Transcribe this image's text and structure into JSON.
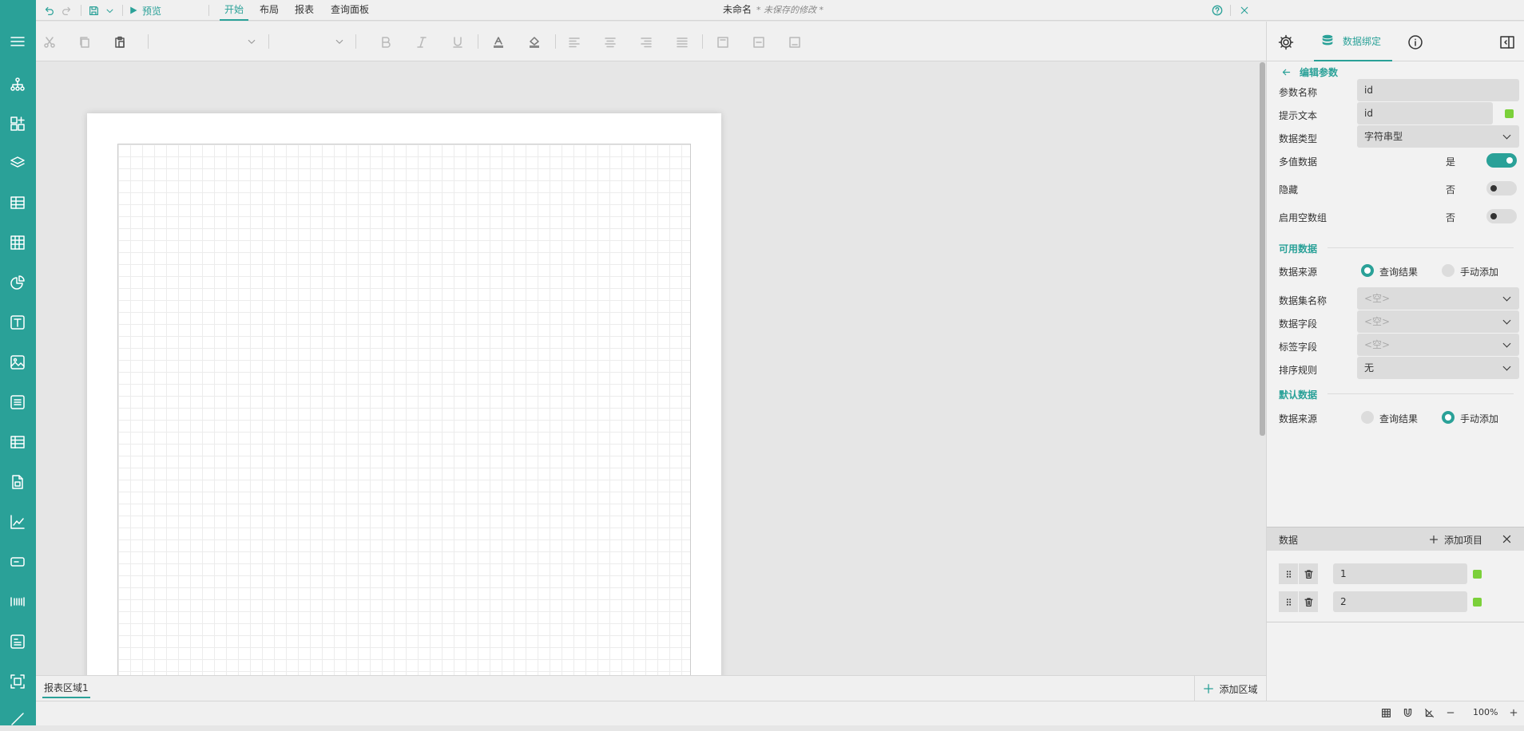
{
  "topbar": {
    "preview_label": "预览",
    "tabs": [
      "开始",
      "布局",
      "报表",
      "查询面板"
    ],
    "doc_title": "未命名",
    "unsaved_note": "* 未保存的修改 *"
  },
  "right_panel": {
    "data_binding_tab": "数据绑定",
    "back_label": "编辑参数",
    "fields": {
      "param_name": {
        "label": "参数名称",
        "value": "id"
      },
      "prompt_text": {
        "label": "提示文本",
        "value": "id"
      },
      "data_type": {
        "label": "数据类型",
        "value": "字符串型"
      }
    },
    "toggles": {
      "multi_value": {
        "label": "多值数据",
        "state": "是",
        "on": true
      },
      "hidden": {
        "label": "隐藏",
        "state": "否",
        "on": false
      },
      "enable_empty_array": {
        "label": "启用空数组",
        "state": "否",
        "on": false
      }
    },
    "available_data": {
      "title": "可用数据",
      "source_label": "数据来源",
      "options": [
        "查询结果",
        "手动添加"
      ],
      "selected": "查询结果",
      "dataset_name": {
        "label": "数据集名称",
        "value": "<空>"
      },
      "data_field": {
        "label": "数据字段",
        "value": "<空>"
      },
      "label_field": {
        "label": "标签字段",
        "value": "<空>"
      },
      "sort_rule": {
        "label": "排序规则",
        "value": "无"
      }
    },
    "default_data": {
      "title": "默认数据",
      "source_label": "数据来源",
      "options": [
        "查询结果",
        "手动添加"
      ],
      "selected": "手动添加"
    },
    "data_list": {
      "title": "数据",
      "add_label": "添加项目",
      "items": [
        "1",
        "2"
      ]
    }
  },
  "bottom": {
    "section_tab": "报表区域1",
    "add_section": "添加区域"
  },
  "status": {
    "zoom": "100%"
  },
  "colors": {
    "accent": "#2aa198",
    "indicator": "#7bd03a"
  }
}
